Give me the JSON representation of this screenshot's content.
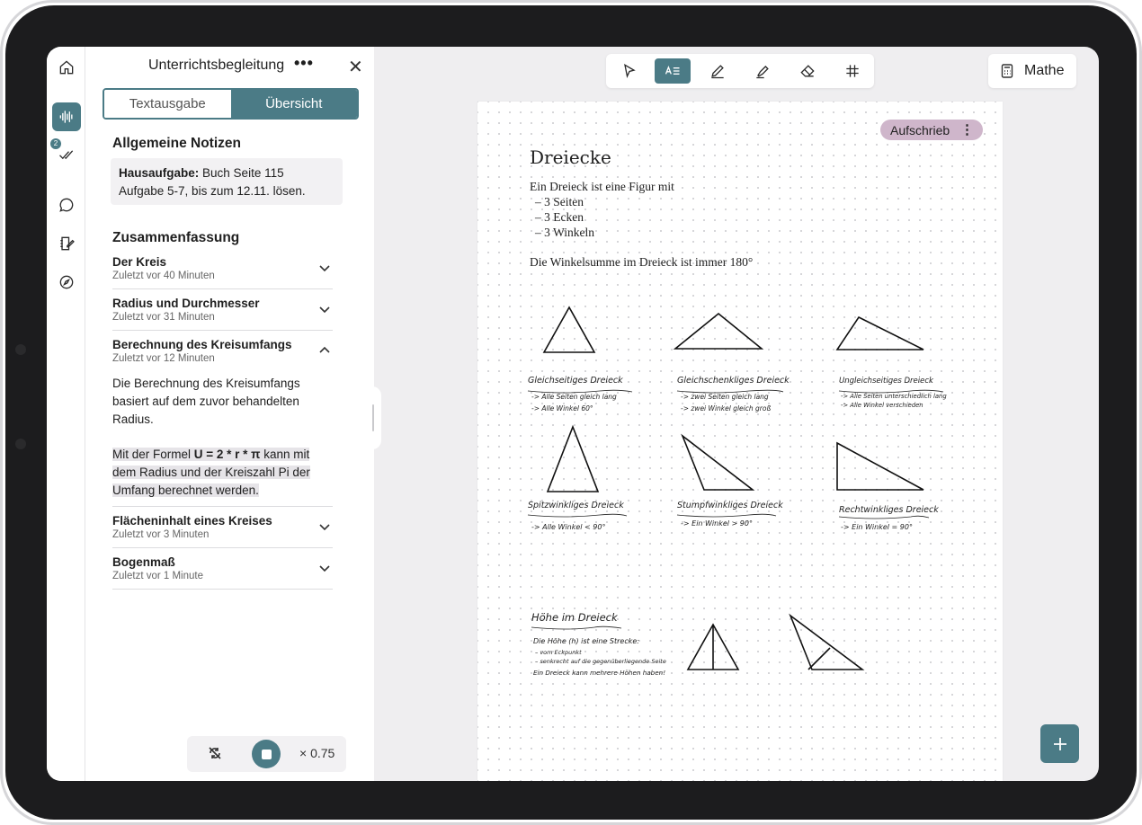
{
  "rail": {
    "badge_count": "2"
  },
  "sidebar": {
    "title": "Unterrichtsbegleitung",
    "more_label": "•••",
    "close_label": "✕",
    "tabs": [
      {
        "label": "Textausgabe",
        "active": false
      },
      {
        "label": "Übersicht",
        "active": true
      }
    ],
    "notes_heading": "Allgemeine Notizen",
    "note": {
      "bold": "Hausaufgabe:",
      "line1_rest": " Buch Seite 115",
      "line2": "Aufgabe 5-7, bis zum 12.11. lösen."
    },
    "summary_heading": "Zusammenfassung",
    "items": [
      {
        "title": "Der Kreis",
        "subtitle": "Zuletzt vor 40 Minuten"
      },
      {
        "title": "Radius und Durchmesser",
        "subtitle": "Zuletzt vor 31 Minuten"
      },
      {
        "title": "Berechnung des Kreisumfangs",
        "subtitle": "Zuletzt vor 12 Minuten"
      },
      {
        "title": "Flächeninhalt eines Kreises",
        "subtitle": "Zuletzt vor 3 Minuten"
      },
      {
        "title": "Bogenmaß",
        "subtitle": "Zuletzt vor 1 Minute"
      }
    ],
    "expanded_body": {
      "p1_l1": "Die Berechnung des Kreisumfangs",
      "p1_l2": "basiert auf dem zuvor behandelten",
      "p1_l3": "Radius.",
      "p2_l1_a": "Mit der Formel ",
      "p2_l1_formula": "U = 2 * r * π",
      "p2_l1_b": " kann mit",
      "p2_l2": "dem Radius und der Kreiszahl Pi der",
      "p2_l3": "Umfang berechnet werden."
    },
    "player": {
      "speed": "× 0.75"
    }
  },
  "subject": {
    "label": "Mathe"
  },
  "page": {
    "tag_label": "Aufschrieb",
    "tag_more": "⋮",
    "title": "Dreiecke",
    "intro": "Ein Dreieck ist eine Figur mit",
    "bullets": [
      "– 3 Seiten",
      "– 3 Ecken",
      "– 3 Winkeln"
    ],
    "angle_sum": "Die Winkelsumme im Dreieck ist immer 180°",
    "sketches": [
      {
        "title": "Gleichseitiges Dreieck",
        "notes": [
          "-> Alle Seiten gleich lang",
          "-> Alle Winkel 60°"
        ]
      },
      {
        "title": "Gleichschenkliges Dreieck",
        "notes": [
          "-> zwei Seiten gleich lang",
          "-> zwei Winkel gleich groß"
        ]
      },
      {
        "title": "Ungleichseitiges Dreieck",
        "notes": [
          "-> Alle Seiten unterschiedlich lang",
          "-> Alle Winkel verschieden"
        ]
      },
      {
        "title": "Spitzwinkliges Dreieck",
        "notes": [
          "-> Alle Winkel < 90°"
        ]
      },
      {
        "title": "Stumpfwinkliges Dreieck",
        "notes": [
          "-> Ein Winkel > 90°"
        ]
      },
      {
        "title": "Rechtwinkliges Dreieck",
        "notes": [
          "-> Ein Winkel = 90°"
        ]
      }
    ],
    "height": {
      "title": "Höhe im Dreieck",
      "line1": "Die Höhe (h) ist eine Strecke:",
      "line2": "– vom Eckpunkt",
      "line3": "– senkrecht auf die gegenüberliegende Seite",
      "line4": "Ein Dreieck kann mehrere Höhen haben!"
    }
  },
  "colors": {
    "accent": "#4b7b86",
    "tag": "#cfb6cb"
  }
}
